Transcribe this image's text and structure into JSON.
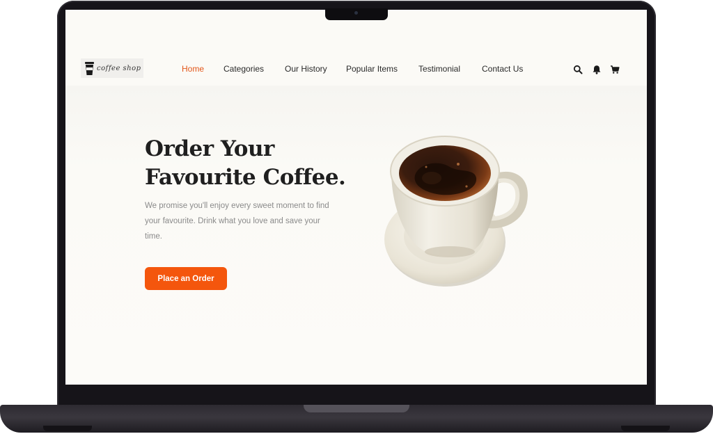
{
  "brand": {
    "logo_text": "coffee shop"
  },
  "nav": {
    "items": [
      {
        "label": "Home",
        "active": true
      },
      {
        "label": "Categories",
        "active": false
      },
      {
        "label": "Our History",
        "active": false
      },
      {
        "label": "Popular Items",
        "active": false
      },
      {
        "label": "Testimonial",
        "active": false
      },
      {
        "label": "Contact Us",
        "active": false
      }
    ]
  },
  "header_icons": [
    "search-icon",
    "bell-icon",
    "cart-icon"
  ],
  "hero": {
    "title_line1": "Order Your",
    "title_line2": "Favourite Coffee.",
    "description": "We promise you'll enjoy every sweet moment to find your favourite. Drink what you love and save your time.",
    "cta_label": "Place an Order"
  },
  "colors": {
    "accent": "#f4560d",
    "nav_active": "#e3571a",
    "background": "#fbfaf6",
    "heading": "#1f1f1f",
    "body_text": "#8a8a8a"
  }
}
